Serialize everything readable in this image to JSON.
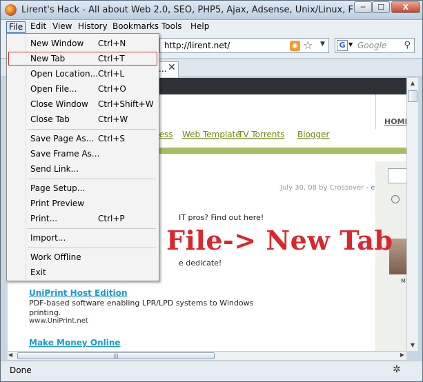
{
  "window": {
    "title": "Lirent's Hack - All about Web 2.0, SEO, PHP5, Ajax, Adsense, Unix/Linux, Free Stuff, Open...",
    "min_glyph": "─",
    "max_glyph": "☐",
    "close_glyph": "X"
  },
  "menubar": {
    "items": [
      "File",
      "Edit",
      "View",
      "History",
      "Bookmarks",
      "Tools",
      "Help"
    ]
  },
  "navbar": {
    "url": "http://lirent.net/",
    "search_placeholder": "Google",
    "search_engine_glyph": "G"
  },
  "tab": {
    "title": "...",
    "close_glyph": "✕"
  },
  "file_menu": {
    "items": [
      {
        "label": "New Window",
        "shortcut": "Ctrl+N"
      },
      {
        "label": "New Tab",
        "shortcut": "Ctrl+T"
      },
      {
        "label": "Open Location...",
        "shortcut": "Ctrl+L"
      },
      {
        "label": "Open File...",
        "shortcut": "Ctrl+O"
      },
      {
        "label": "Close Window",
        "shortcut": "Ctrl+Shift+W"
      },
      {
        "label": "Close Tab",
        "shortcut": "Ctrl+W"
      },
      {
        "label": "Save Page As...",
        "shortcut": "Ctrl+S"
      },
      {
        "label": "Save Frame As...",
        "shortcut": ""
      },
      {
        "label": "Send Link...",
        "shortcut": ""
      },
      {
        "label": "Page Setup...",
        "shortcut": ""
      },
      {
        "label": "Print Preview",
        "shortcut": ""
      },
      {
        "label": "Print...",
        "shortcut": "Ctrl+P"
      },
      {
        "label": "Import...",
        "shortcut": ""
      },
      {
        "label": "Work Offline",
        "shortcut": ""
      },
      {
        "label": "Exit",
        "shortcut": ""
      }
    ],
    "highlighted": "New Tab"
  },
  "page": {
    "nav_links": [
      "ress",
      "Web Template",
      "TV Torrents",
      "Blogger"
    ],
    "home_link": "HOME",
    "post_date": "July 30, 08 by Crossover",
    "post_date_extra": "- e",
    "ad_snippet_1": "IT pros? Find out here!",
    "ad_snippet_2": "e dedicate!",
    "ad2_title": "UniPrint Host Edition",
    "ad2_desc_1": "PDF-based software enabling LPR/LPD systems to Windows",
    "ad2_desc_2": "printing.",
    "ad2_url": "www.UniPrint.net",
    "ad3_title": "Make Money Online",
    "annotation": "File-> New Tab",
    "right_label": "M"
  },
  "statusbar": {
    "text": "Done"
  },
  "colors": {
    "highlight_border": "#cc3333",
    "annotation": "#d9272d",
    "nav_link": "#6a8a10",
    "ad_link": "#1a9ac9"
  }
}
